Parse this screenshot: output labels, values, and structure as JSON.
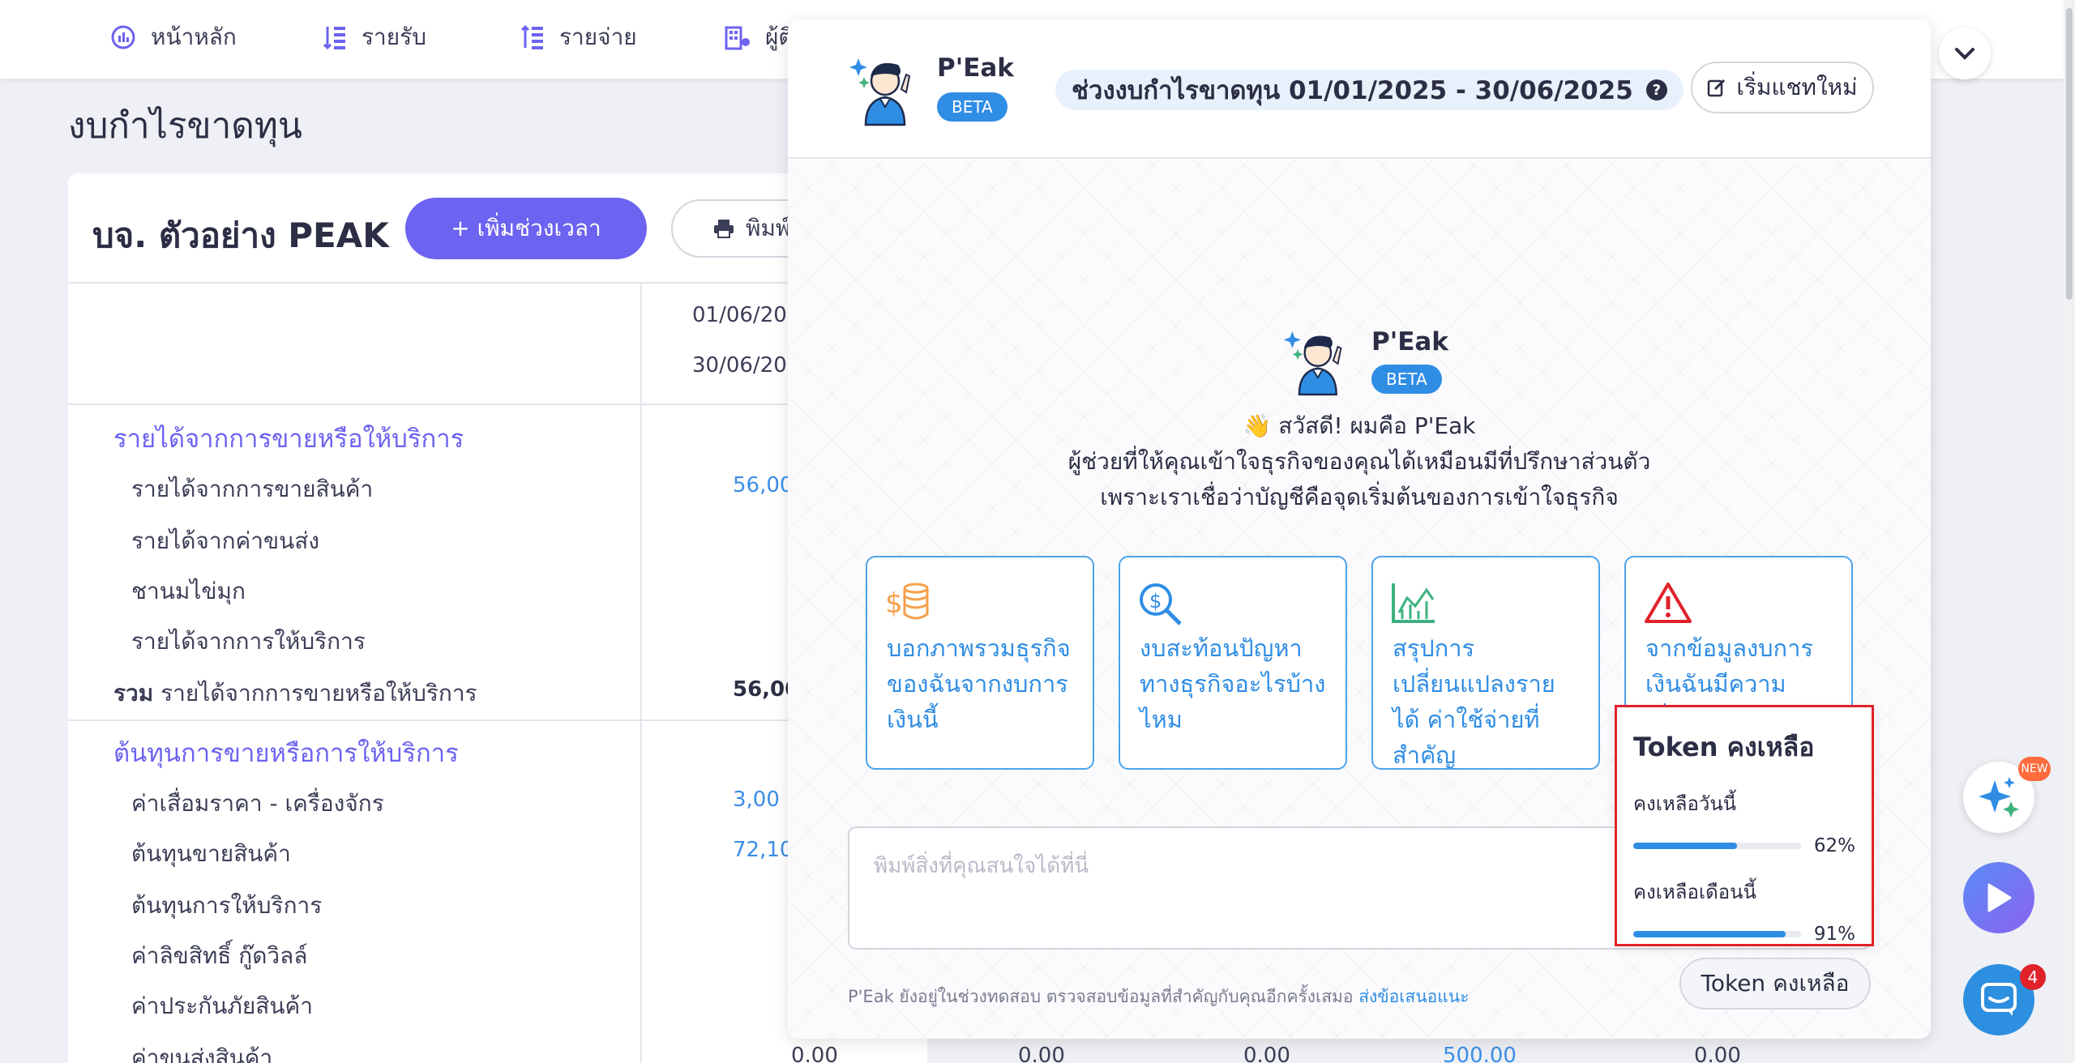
{
  "nav": {
    "items": [
      {
        "label": "หน้าหลัก",
        "icon": "chart-icon"
      },
      {
        "label": "รายรับ",
        "icon": "income-icon"
      },
      {
        "label": "รายจ่าย",
        "icon": "expense-icon"
      },
      {
        "label": "ผู้ติ",
        "icon": "contacts-icon"
      }
    ]
  },
  "page": {
    "title": "งบกำไรขาดทุน"
  },
  "report": {
    "company": "บจ. ตัวอย่าง PEAK",
    "add_period": "+ เพิ่มช่วงเวลา",
    "print": "พิมพ์",
    "date_from": "01/06/20",
    "date_to": "30/06/20",
    "section1": "รายได้จากการขายหรือให้บริการ",
    "rows1": [
      {
        "label": "รายได้จากการขายสินค้า",
        "value": "56,00"
      },
      {
        "label": "รายได้จากค่าขนส่ง",
        "value": ""
      },
      {
        "label": "ชานมไข่มุก",
        "value": ""
      },
      {
        "label": "รายได้จากการให้บริการ",
        "value": ""
      }
    ],
    "total1_prefix": "รวม",
    "total1_label": "รายได้จากการขายหรือให้บริการ",
    "total1_value": "56,00",
    "section2": "ต้นทุนการขายหรือการให้บริการ",
    "rows2": [
      {
        "label": "ค่าเสื่อมราคา - เครื่องจักร",
        "value": "3,00"
      },
      {
        "label": "ต้นทุนขายสินค้า",
        "value": "72,10"
      },
      {
        "label": "ต้นทุนการให้บริการ",
        "value": ""
      },
      {
        "label": "ค่าลิขสิทธิ์ กู๊ดวิลล์",
        "value": ""
      },
      {
        "label": "ค่าประกันภัยสินค้า",
        "value": ""
      },
      {
        "label": "ค่าขนส่งสินค้า",
        "value": ""
      }
    ],
    "bottom_values": [
      "0.00",
      "0.00",
      "0.00",
      "500.00",
      "0.00"
    ]
  },
  "chat": {
    "bot_name": "P'Eak",
    "beta": "BETA",
    "period": "ช่วงงบกำไรขาดทุน 01/01/2025 - 30/06/2025",
    "help": "?",
    "new_chat": "เริ่มแชทใหม่",
    "greeting_line1": "👋 สวัสดี! ผมคือ P'Eak",
    "greeting_line2": "ผู้ช่วยที่ให้คุณเข้าใจธุรกิจของคุณได้เหมือนมีที่ปรึกษาส่วนตัว",
    "greeting_line3": "เพราะเราเชื่อว่าบัญชีคือจุดเริ่มต้นของการเข้าใจธุรกิจ",
    "cards": [
      {
        "text": "บอกภาพรวมธุรกิจของฉันจากงบการเงินนี้",
        "icon": "coins-icon",
        "color": "#f5a04a"
      },
      {
        "text": "งบสะท้อนปัญหาทางธุรกิจอะไรบ้างไหม",
        "icon": "magnifier-dollar-icon",
        "color": "#2f8de4"
      },
      {
        "text": "สรุปการเปลี่ยนแปลงรายได้ ค่าใช้จ่ายที่สำคัญ",
        "icon": "line-chart-icon",
        "color": "#3fb27f"
      },
      {
        "text": "จากข้อมูลงบการเงินฉันมีความเสี่ยงทางการเงินหรือไม่",
        "icon": "warning-icon",
        "color": "#e0222a"
      }
    ],
    "input_placeholder": "พิมพ์สิ่งที่คุณสนใจได้ที่นี่",
    "footnote": "P'Eak ยังอยู่ในช่วงทดสอบ ตรวจสอบข้อมูลที่สำคัญกับคุณอีกครั้งเสมอ",
    "feedback_link": "ส่งข้อเสนอแนะ",
    "token_button": "Token คงเหลือ"
  },
  "token_popup": {
    "title": "Token คงเหลือ",
    "today_label": "คงเหลือวันนี้",
    "today_pct": 62,
    "today_text": "62%",
    "month_label": "คงเหลือเดือนนี้",
    "month_pct": 91,
    "month_text": "91%"
  },
  "floating": {
    "new_badge": "NEW",
    "chat_count": "4"
  }
}
